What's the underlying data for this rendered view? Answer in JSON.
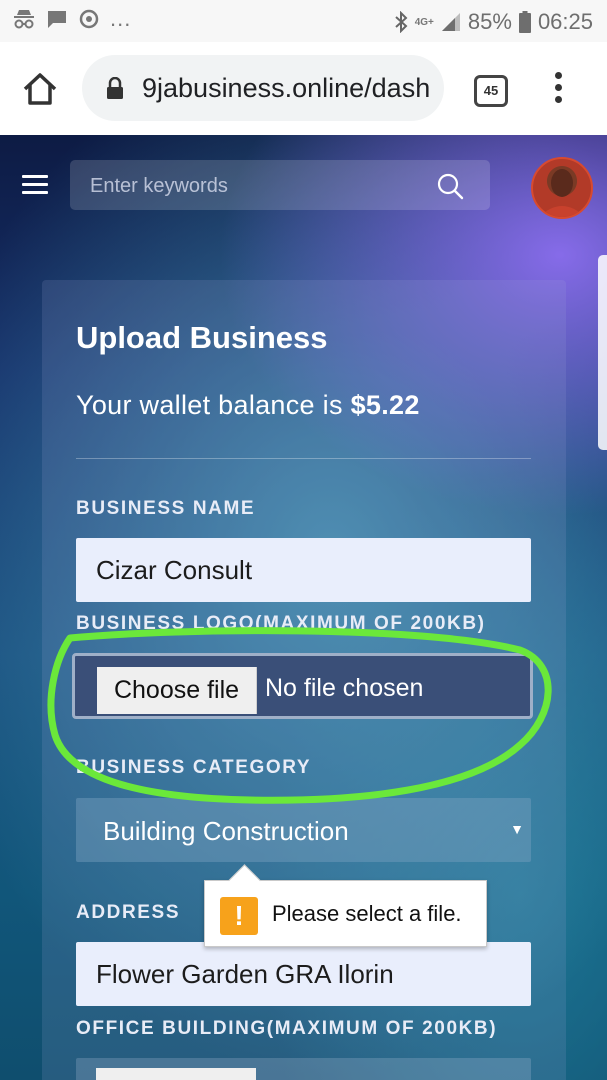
{
  "status_bar": {
    "icons_left": [
      "incognito-icon",
      "chat-icon",
      "sync-icon"
    ],
    "dots": "...",
    "network": "4G+",
    "battery": "85%",
    "time": "06:25"
  },
  "browser": {
    "url": "9jabusiness.online/dash",
    "tab_count": "45"
  },
  "page": {
    "search": {
      "placeholder": "Enter keywords"
    },
    "card": {
      "title": "Upload Business",
      "wallet_prefix": "Your wallet balance is ",
      "wallet_amount": "$5.22",
      "fields": {
        "business_name_label": "BUSINESS NAME",
        "business_name_value": "Cizar Consult",
        "logo_label": "BUSINESS LOGO(MAXIMUM OF 200KB)",
        "choose_file": "Choose file",
        "no_file": "No file chosen",
        "category_label": "BUSINESS CATEGORY",
        "category_value": "Building Construction",
        "address_label": "ADDRESS",
        "address_value": "Flower Garden GRA Ilorin",
        "office_label": "OFFICE BUILDING(MAXIMUM OF 200KB)"
      }
    },
    "tooltip": "Please select a file."
  },
  "colors": {
    "highlight": "#6be83a",
    "warning": "#f7a21b",
    "input_bg": "#e9eefc"
  }
}
